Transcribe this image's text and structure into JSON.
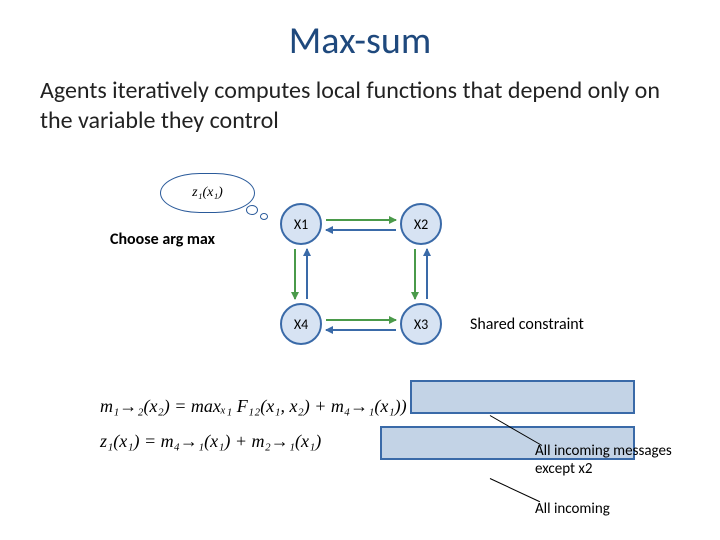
{
  "title": "Max-sum",
  "subtitle": "Agents iteratively computes local functions that depend only on the variable they control",
  "nodes": {
    "x1": "X1",
    "x2": "X2",
    "x3": "X3",
    "x4": "X4"
  },
  "labels": {
    "choose": "Choose arg max",
    "shared": "Shared constraint",
    "cloud": "z₁(x₁)"
  },
  "equations": {
    "m12": "m₁→₂(x₂) = maxₓ₁ F₁₂(x₁, x₂) + m₄→₁(x₁))",
    "z1": "z₁(x₁) = m₄→₁(x₁) + m₂→₁(x₁)"
  },
  "callouts": {
    "c1": "All incoming messages except x2",
    "c2": "All incoming"
  }
}
